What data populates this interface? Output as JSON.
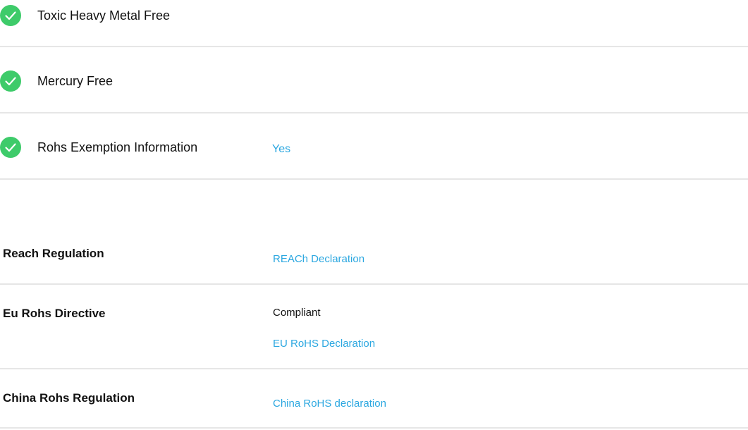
{
  "checklist": {
    "items": [
      {
        "label": "Toxic Heavy Metal Free",
        "value": ""
      },
      {
        "label": "Mercury Free",
        "value": ""
      },
      {
        "label": "Rohs Exemption Information",
        "value": "Yes"
      }
    ],
    "check_color": "#3ecb6a",
    "icon": "check-circle-icon"
  },
  "regulations": [
    {
      "label": "Reach Regulation",
      "status": "",
      "links": [
        "REACh Declaration"
      ]
    },
    {
      "label": "Eu Rohs Directive",
      "status": "Compliant",
      "links": [
        "EU RoHS Declaration"
      ]
    },
    {
      "label": "China Rohs Regulation",
      "status": "",
      "links": [
        "China RoHS declaration"
      ]
    }
  ],
  "colors": {
    "link": "#2ba7e0",
    "divider": "#e6e6e6"
  }
}
